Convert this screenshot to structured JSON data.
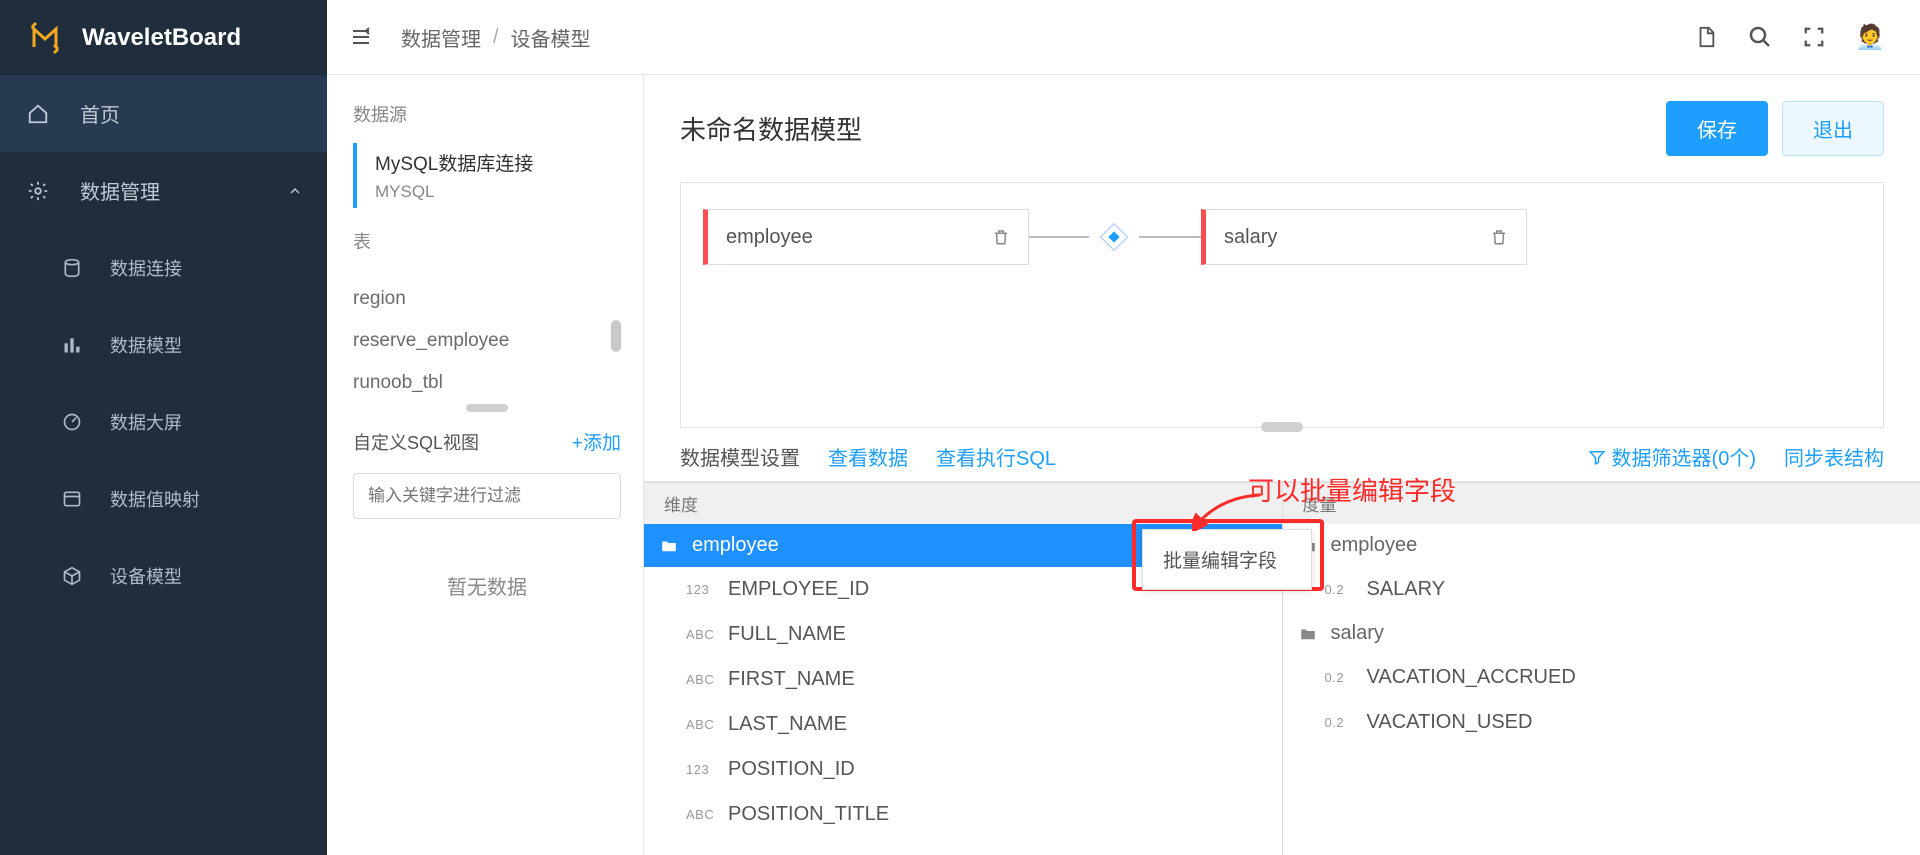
{
  "brand": "WaveletBoard",
  "breadcrumb": {
    "a": "数据管理",
    "b": "设备模型"
  },
  "sidebar": {
    "home": "首页",
    "data_mgmt": "数据管理",
    "items": [
      "数据连接",
      "数据模型",
      "数据大屏",
      "数据值映射",
      "设备模型"
    ]
  },
  "ds": {
    "title": "数据源",
    "conn_name": "MySQL数据库连接",
    "conn_type": "MYSQL",
    "tables_title": "表",
    "tables": [
      "region",
      "reserve_employee",
      "runoob_tbl"
    ],
    "custom_sql": "自定义SQL视图",
    "add": "+添加",
    "filter_ph": "输入关键字进行过滤",
    "empty": "暂无数据"
  },
  "model": {
    "title": "未命名数据模型",
    "save": "保存",
    "exit": "退出",
    "node_a": "employee",
    "node_b": "salary"
  },
  "tabs": {
    "a": "数据模型设置",
    "b": "查看数据",
    "c": "查看执行SQL",
    "filter": "数据筛选器(0个)",
    "sync": "同步表结构"
  },
  "dim": {
    "header": "维度",
    "folder": "employee",
    "fields": [
      {
        "t": "123",
        "n": "EMPLOYEE_ID"
      },
      {
        "t": "ABC",
        "n": "FULL_NAME"
      },
      {
        "t": "ABC",
        "n": "FIRST_NAME"
      },
      {
        "t": "ABC",
        "n": "LAST_NAME"
      },
      {
        "t": "123",
        "n": "POSITION_ID"
      },
      {
        "t": "ABC",
        "n": "POSITION_TITLE"
      }
    ]
  },
  "mea": {
    "header": "度量",
    "folders": [
      "employee",
      "salary"
    ],
    "emp_field": {
      "t": "0.2",
      "n": "SALARY"
    },
    "sal_fields": [
      {
        "t": "0.2",
        "n": "VACATION_ACCRUED"
      },
      {
        "t": "0.2",
        "n": "VACATION_USED"
      }
    ]
  },
  "ctx_menu": "批量编辑字段",
  "annotation": "可以批量编辑字段"
}
